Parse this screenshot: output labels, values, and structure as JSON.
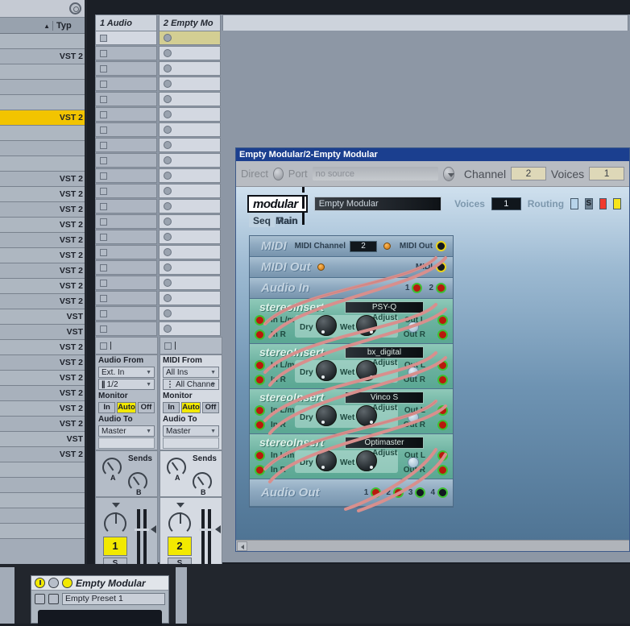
{
  "browser": {
    "header": {
      "name_col": "",
      "sort_arrow": "▲",
      "type_col": "Typ"
    },
    "stop_icon": "stop-circle-icon",
    "rows": [
      {
        "type": ""
      },
      {
        "type": "VST 2",
        "selected": false
      },
      {
        "type": ""
      },
      {
        "type": ""
      },
      {
        "type": ""
      },
      {
        "type": "VST 2",
        "selected": true
      },
      {
        "type": ""
      },
      {
        "type": ""
      },
      {
        "type": ""
      },
      {
        "type": "VST 2"
      },
      {
        "type": "VST 2"
      },
      {
        "type": "VST 2"
      },
      {
        "type": "VST 2"
      },
      {
        "type": "VST 2"
      },
      {
        "type": "VST 2"
      },
      {
        "type": "VST 2"
      },
      {
        "type": "VST 2"
      },
      {
        "type": "VST 2"
      },
      {
        "type": "VST"
      },
      {
        "type": "VST"
      },
      {
        "type": "VST 2"
      },
      {
        "type": "VST 2"
      },
      {
        "type": "VST 2"
      },
      {
        "type": "VST 2"
      },
      {
        "type": "VST 2"
      },
      {
        "type": "VST 2"
      },
      {
        "type": "VST"
      },
      {
        "type": "VST 2"
      },
      {
        "type": ""
      },
      {
        "type": ""
      },
      {
        "type": ""
      },
      {
        "type": ""
      },
      {
        "type": ""
      }
    ]
  },
  "session": {
    "tracks": [
      {
        "name": "1 Audio"
      },
      {
        "name": "2 Empty Mo"
      }
    ],
    "slot_count": 20,
    "selected_slot": {
      "track": 1,
      "row": 0
    },
    "selected_slot_color": "#d3ce93",
    "stop_row_label": ""
  },
  "mixer": {
    "track1": {
      "io_label": "Audio From",
      "input_type": "Ext. In",
      "input_channel": "1/2",
      "monitor_label": "Monitor",
      "monitor_options": [
        "In",
        "Auto",
        "Off"
      ],
      "monitor_active": "Auto",
      "output_label": "Audio To",
      "output": "Master",
      "sends_label": "Sends",
      "send_a": "A",
      "send_b": "B",
      "track_number": "1",
      "solo_label": "S",
      "record_armed": false
    },
    "track2": {
      "io_label": "MIDI From",
      "input_type": "All Ins",
      "input_channel": "All Channe",
      "monitor_label": "Monitor",
      "monitor_options": [
        "In",
        "Auto",
        "Off"
      ],
      "monitor_active": "Auto",
      "output_label": "Audio To",
      "output": "Master",
      "sends_label": "Sends",
      "send_a": "A",
      "send_b": "B",
      "track_number": "2",
      "solo_label": "S",
      "record_armed": true
    },
    "arm_color": "#f21b0e",
    "number_box_color": "#f2e900"
  },
  "plugin_window": {
    "title": "Empty Modular/2-Empty Modular",
    "title_bar_color": "#1b3f8f",
    "toolbar": {
      "direct_label": "Direct",
      "port_label": "Port",
      "port_value": "no source",
      "channel_label": "Channel",
      "channel_value": "2",
      "voices_label": "Voices",
      "voices_value": "1"
    },
    "modular": {
      "logo_text": "modular",
      "patch_name": "Empty Modular",
      "voices_label": "Voices",
      "voices_value": "1",
      "routing_label": "Routing",
      "routing_solo": "S",
      "routing_colors": [
        "#b8d4ea",
        "#f03a2e",
        "#f7e41c"
      ],
      "tabs": [
        {
          "label": "Seq",
          "active": true
        },
        {
          "label": "Main",
          "active": false
        },
        {
          "label": "Rain",
          "active": false
        }
      ]
    },
    "rack": [
      {
        "kind": "midi",
        "title": "MIDI",
        "channel_label": "MIDI Channel",
        "channel_value": "2",
        "out_label": "MIDI Out"
      },
      {
        "kind": "midi-out",
        "title": "MIDI Out",
        "out_label": "MIDI"
      },
      {
        "kind": "audio-in",
        "title": "Audio In",
        "ports": [
          "1",
          "2"
        ]
      },
      {
        "kind": "insert",
        "title": "stereoInsert",
        "plugin_name": "PSY-Q",
        "in_labels": [
          "In L/m",
          "In R"
        ],
        "out_labels": [
          "Out L",
          "Out R"
        ],
        "dry_label": "Dry",
        "wet_label": "Wet",
        "adjust_label": "Adjust"
      },
      {
        "kind": "insert",
        "title": "stereoInsert",
        "plugin_name": "bx_digital",
        "in_labels": [
          "In L/m",
          "In R"
        ],
        "out_labels": [
          "Out L",
          "Out R"
        ],
        "dry_label": "Dry",
        "wet_label": "Wet",
        "adjust_label": "Adjust"
      },
      {
        "kind": "insert",
        "title": "stereoInsert",
        "plugin_name": "Vinco S",
        "in_labels": [
          "In L/m",
          "In R"
        ],
        "out_labels": [
          "Out L",
          "Out R"
        ],
        "dry_label": "Dry",
        "wet_label": "Wet",
        "adjust_label": "Adjust"
      },
      {
        "kind": "insert",
        "title": "stereoInsert",
        "plugin_name": "Optimaster",
        "in_labels": [
          "In L/m",
          "In R"
        ],
        "out_labels": [
          "Out L",
          "Out R"
        ],
        "dry_label": "Dry",
        "wet_label": "Wet",
        "adjust_label": "Adjust"
      },
      {
        "kind": "audio-out",
        "title": "Audio Out",
        "ports": [
          "1",
          "2",
          "3",
          "4"
        ]
      }
    ]
  },
  "device_panel": {
    "device_title": "Empty Modular",
    "power_icon": "power-icon",
    "dropdown_icon": "chevron-down-icon",
    "wrench_icon": "wrench-icon",
    "folder_icon": "folder-icon",
    "save_icon": "save-disk-icon",
    "preset_name": "Empty Preset 1"
  }
}
